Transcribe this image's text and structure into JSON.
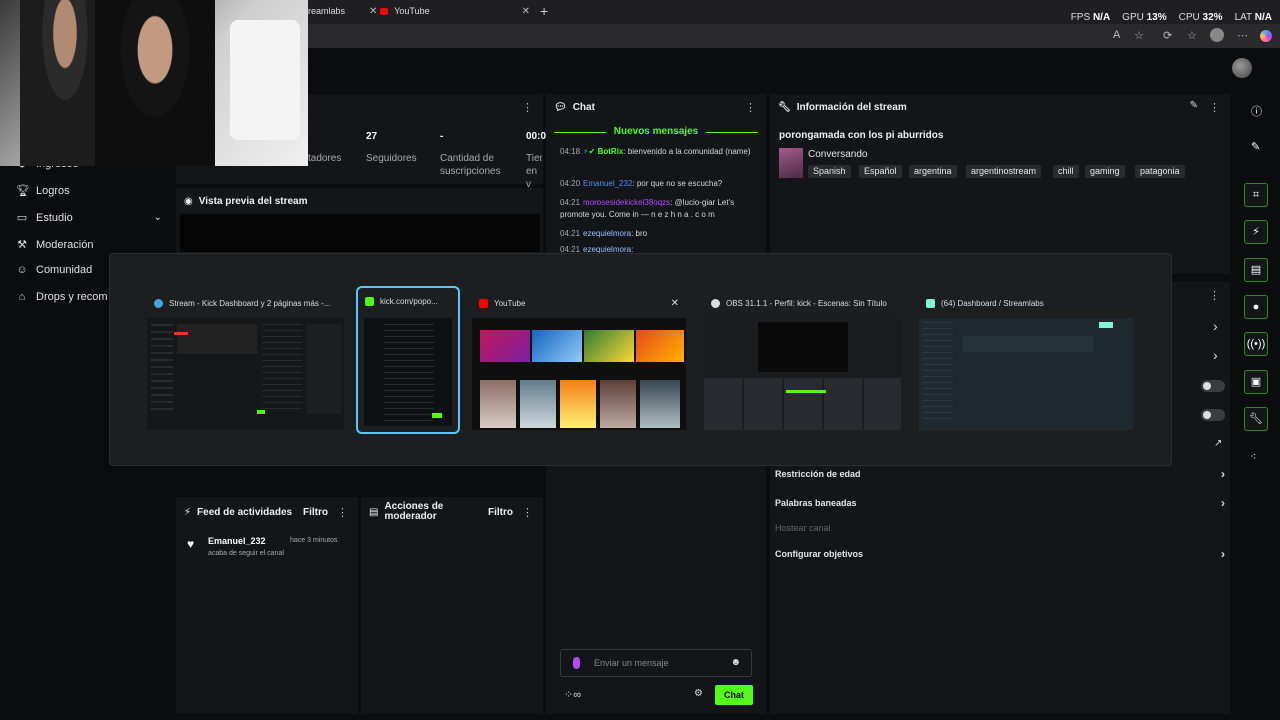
{
  "browser": {
    "tabs": [
      {
        "label": "reamlabs"
      },
      {
        "label": "YouTube"
      }
    ],
    "new_tab": "+",
    "perf": {
      "fps_label": "FPS",
      "fps": "N/A",
      "gpu_label": "GPU",
      "gpu": "13%",
      "cpu_label": "CPU",
      "cpu": "32%",
      "lat_label": "LAT",
      "lat": "N/A"
    }
  },
  "sidebar": {
    "items": [
      {
        "label": "Ingresos",
        "icon": "dollar-icon"
      },
      {
        "label": "Logros",
        "icon": "trophy-icon"
      },
      {
        "label": "Estudio",
        "icon": "studio-icon"
      },
      {
        "label": "Moderación",
        "icon": "hammer-icon"
      },
      {
        "label": "Comunidad",
        "icon": "people-icon"
      },
      {
        "label": "Drops y recom",
        "icon": "gift-icon"
      }
    ]
  },
  "stats": [
    {
      "value": "",
      "label": "tadores"
    },
    {
      "value": "27",
      "label": "Seguidores"
    },
    {
      "value": "-",
      "label": "Cantidad de suscripciones"
    },
    {
      "value": "00:0",
      "label": "Tiem en v"
    }
  ],
  "preview": {
    "title": "Vista previa del stream"
  },
  "chat": {
    "title": "Chat",
    "new_messages": "Nuevos mensajes",
    "messages": [
      {
        "time": "04:18",
        "user": "BotRix",
        "text": "bienvenido a la comunidad (name)"
      },
      {
        "time": "04:20",
        "user": "Emanuel_232",
        "text": "por que no se escucha?"
      },
      {
        "time": "04:21",
        "user": "morosesidekickel38oqzs",
        "text": "@lucio-giar Let's promote you. Come in — n e z h n a . c o m"
      },
      {
        "time": "04:21",
        "user": "ezequielmora",
        "text": "bro"
      },
      {
        "time": "04:21",
        "user": "ezequielmora",
        "text": ""
      }
    ],
    "input_placeholder": "Enviar un mensaje",
    "send_label": "Chat"
  },
  "info": {
    "title": "Información del stream",
    "stream_title": "porongamada con los pi aburridos",
    "category": "Conversando",
    "tags": [
      "Spanish",
      "Español",
      "argentina",
      "argentinostream",
      "chill",
      "gaming",
      "patagonia"
    ]
  },
  "switcher": {
    "windows": [
      {
        "title": "Stream - Kick Dashboard y 2 páginas más -...",
        "favicon_color": "#4aa3df"
      },
      {
        "title": "kick.com/popo...",
        "favicon_color": "#53fc18",
        "selected": true
      },
      {
        "title": "YouTube",
        "favicon_color": "#ff0000",
        "close": "✕"
      },
      {
        "title": "OBS 31.1.1 - Perfil: kick - Escenas: Sin Título",
        "favicon_color": "#cccccc"
      },
      {
        "title": "(64) Dashboard / Streamlabs",
        "favicon_color": "#80f5d2"
      }
    ]
  },
  "activity": {
    "title": "Feed de actividades",
    "filter": "Filtro",
    "user": "Emanuel_232",
    "time": "hace 3 minutos",
    "text": "acaba de seguir el canal"
  },
  "mod_actions": {
    "title": "Acciones de moderador",
    "filter": "Filtro"
  },
  "settings_rows": [
    {
      "label": "Restricción de edad"
    },
    {
      "label": "Palabras baneadas"
    },
    {
      "label": "Hostear canal"
    },
    {
      "label": "Configurar objetivos"
    }
  ],
  "colors": {
    "accent": "#53fc18",
    "panel": "#141518",
    "bg": "#0b0c0d"
  }
}
